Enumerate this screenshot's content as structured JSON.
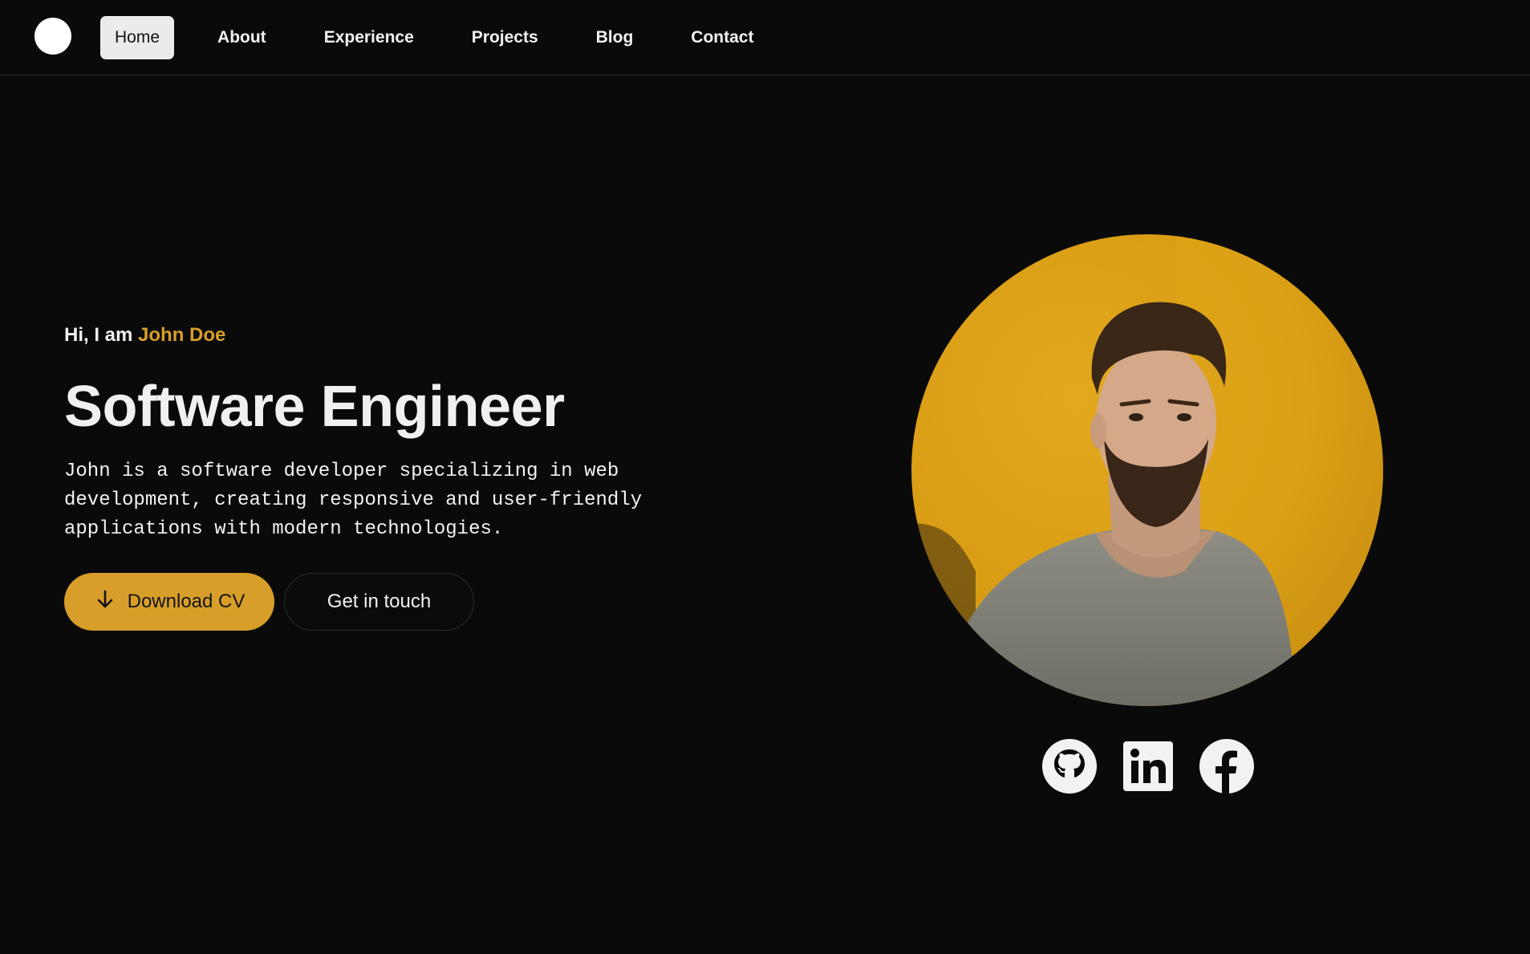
{
  "nav": {
    "items": [
      {
        "label": "Home",
        "active": true
      },
      {
        "label": "About"
      },
      {
        "label": "Experience"
      },
      {
        "label": "Projects"
      },
      {
        "label": "Blog"
      },
      {
        "label": "Contact"
      }
    ]
  },
  "hero": {
    "greeting_prefix": "Hi, I am ",
    "name": "John Doe",
    "title": "Software Engineer",
    "description": "John is a software developer specializing in web development, creating responsive and user-friendly applications with modern technologies.",
    "primary_button": {
      "label": "Download CV",
      "icon": "download-arrow-icon"
    },
    "secondary_button": {
      "label": "Get in touch"
    }
  },
  "profile_image": {
    "icon": "portrait-photo"
  },
  "socials": [
    {
      "icon": "github-icon"
    },
    {
      "icon": "linkedin-icon"
    },
    {
      "icon": "facebook-icon"
    }
  ],
  "colors": {
    "background": "#0a0a0a",
    "accent": "#d89e2a",
    "text": "#f0f0f0",
    "active_nav_bg": "#ebebeb"
  }
}
